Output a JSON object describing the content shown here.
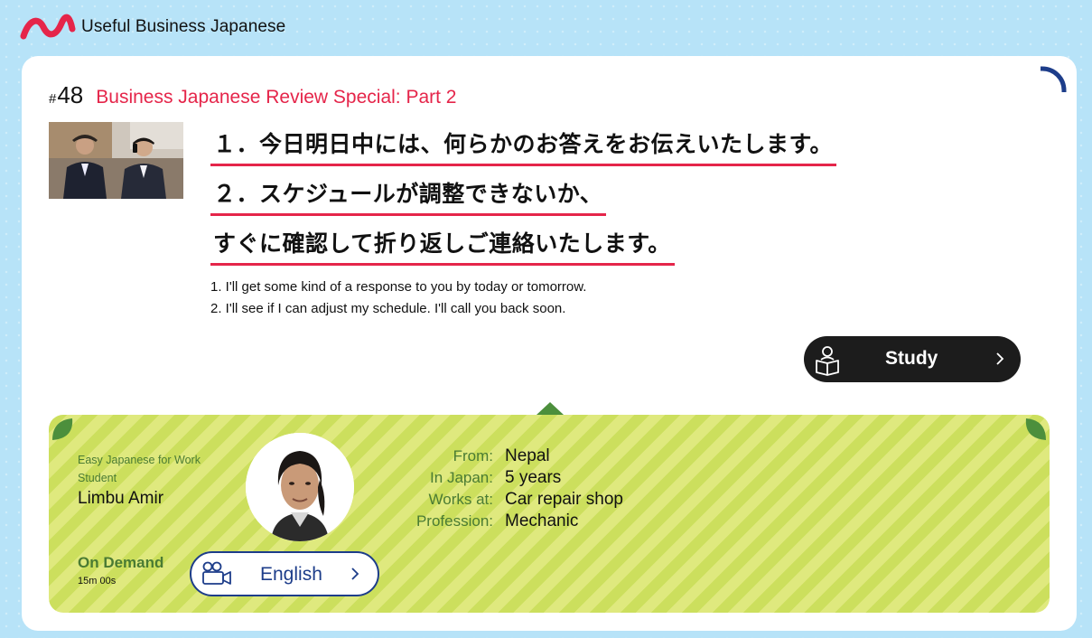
{
  "header": {
    "brand": "Useful Business Japanese"
  },
  "episode": {
    "hash": "#",
    "number": "48",
    "title": "Business Japanese Review Special: Part 2",
    "jp_lines": [
      "１．今日明日中には、何らかのお答えをお伝えいたします。",
      "２．スケジュールが調整できないか、",
      "すぐに確認して折り返しご連絡いたします。"
    ],
    "en_lines": [
      "1. I'll get some kind of a response to you by today or tomorrow.",
      "2. I'll see if I can adjust my schedule. I'll call you back soon."
    ],
    "study_label": "Study"
  },
  "profile": {
    "program_line1": "Easy Japanese for Work",
    "program_line2": "Student",
    "name": "Limbu Amir",
    "info": [
      {
        "label": "From:",
        "value": "Nepal"
      },
      {
        "label": "In Japan:",
        "value": "5 years"
      },
      {
        "label": "Works at:",
        "value": "Car repair shop"
      },
      {
        "label": "Profession:",
        "value": "Mechanic"
      }
    ],
    "on_demand": "On Demand",
    "duration": "15m 00s",
    "language_button": "English"
  },
  "colors": {
    "background": "#b7e3f8",
    "accent_red": "#e5254a",
    "profile_green": "#4a7b33",
    "stripe_light": "#dfe97e",
    "stripe_dark": "#ccdf5d",
    "english_blue": "#1d3d8a",
    "study_dark": "#1c1c1c"
  },
  "icons": [
    "logo-wave-icon",
    "corner-arc-icon",
    "reading-person-icon",
    "chevron-right-icon",
    "leaf-icon",
    "video-camera-icon"
  ]
}
